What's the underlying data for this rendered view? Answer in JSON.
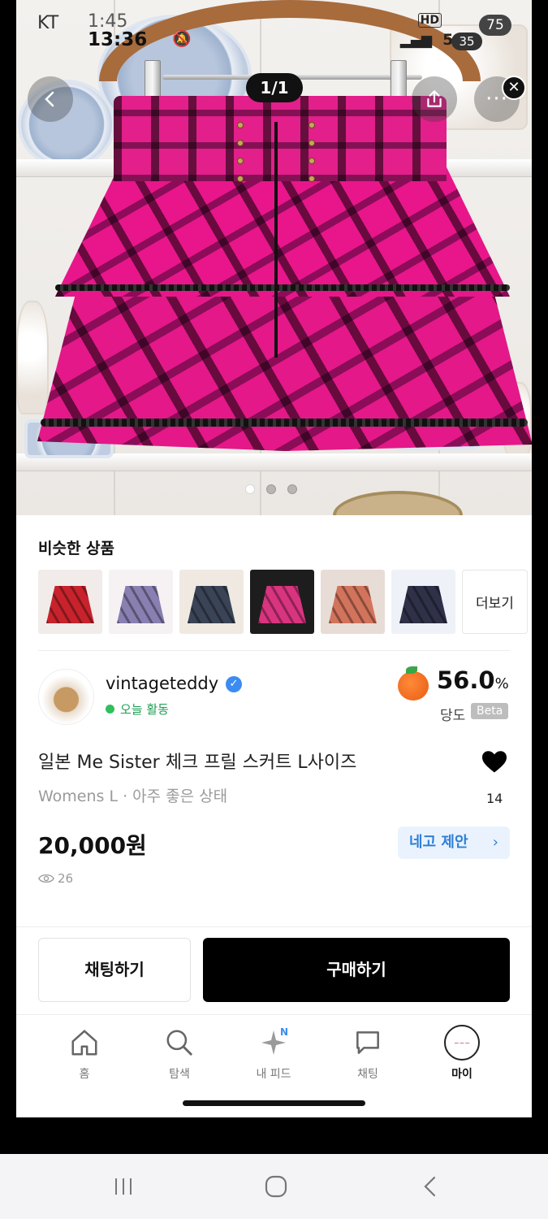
{
  "status_bar": {
    "carrier": "KT",
    "time_under": "1:45",
    "time": "13:36",
    "network": "5G",
    "hd": "HD",
    "battery_top": "75",
    "battery": "35"
  },
  "image_viewer": {
    "counter": "1/1",
    "back_icon": "chevron-left-icon",
    "share_icon": "share-icon",
    "more_icon": "more-icon",
    "close_icon": "close-icon",
    "close_label": "✕"
  },
  "similar": {
    "title": "비슷한 상품",
    "more_label": "더보기",
    "items": [
      {
        "color": "#c8232c",
        "bg": "#f1ecea"
      },
      {
        "color": "#8a7fb1",
        "bg": "#f6f2f3"
      },
      {
        "color": "#3a4456",
        "bg": "#efe9e2"
      },
      {
        "color": "#d8347f",
        "bg": "#1d1d1d"
      },
      {
        "color": "#d2735c",
        "bg": "#e8dcd6"
      },
      {
        "color": "#2e3147",
        "bg": "#eef1f7"
      }
    ]
  },
  "seller": {
    "name": "vintageteddy",
    "activity": "오늘 활동",
    "temperature": "56.0",
    "temperature_unit": "%",
    "temperature_label": "당도",
    "beta": "Beta"
  },
  "product": {
    "title": "일본 Me Sister 체크 프릴 스커트 L사이즈",
    "meta": "Womens L · 아주 좋은 상태",
    "price": "20,000원",
    "offer_label": "네고 제안",
    "offer_chevron": "›",
    "likes": "14",
    "views": "26"
  },
  "actions": {
    "chat": "채팅하기",
    "buy": "구매하기"
  },
  "tabbar": {
    "home": "홈",
    "search": "탐색",
    "feed": "내 피드",
    "feed_badge": "N",
    "chat": "채팅",
    "my": "마이"
  },
  "colors": {
    "accent_blue": "#2f7fd8",
    "activity_green": "#1f9d55",
    "skirt_pink": "#e41888"
  }
}
